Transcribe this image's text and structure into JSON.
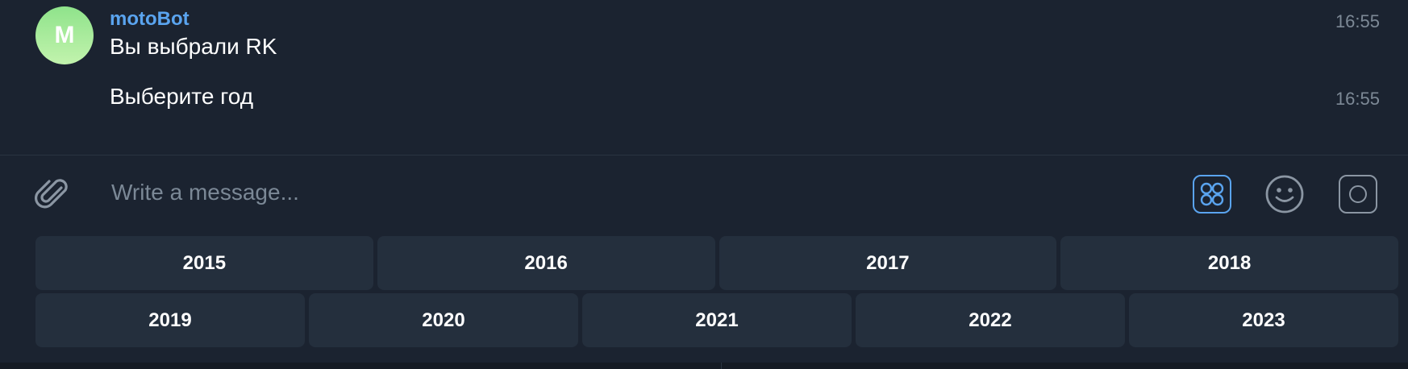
{
  "chat": {
    "avatar_letter": "M",
    "sender": "motoBot",
    "messages": [
      {
        "text": "Вы выбрали RK",
        "time": "16:55"
      },
      {
        "text": "Выберите год",
        "time": "16:55"
      }
    ]
  },
  "composer": {
    "placeholder": "Write a message..."
  },
  "keyboard": {
    "row1": [
      "2015",
      "2016",
      "2017",
      "2018"
    ],
    "row2": [
      "2019",
      "2020",
      "2021",
      "2022",
      "2023"
    ]
  },
  "colors": {
    "background": "#1b2330",
    "key": "#242f3d",
    "accent": "#5aa4ef",
    "avatar_gradient_top": "#8fe38b",
    "avatar_gradient_bottom": "#c2f3ad"
  },
  "icons": {
    "attach": "paperclip-icon",
    "commands": "bot-commands-icon",
    "emoji": "emoji-icon",
    "record": "record-icon"
  }
}
